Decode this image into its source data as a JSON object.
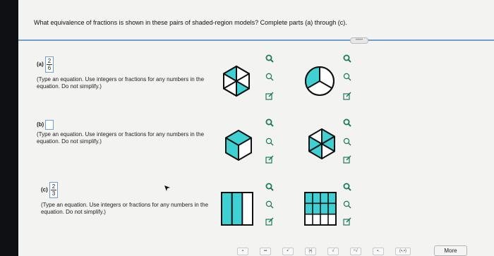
{
  "question": "What equivalence of fractions is shown in these pairs of shaded-region models? Complete parts (a) through (c).",
  "more_pill": "•••••",
  "parts": [
    {
      "label": "(a)",
      "fraction": {
        "numerator": "2",
        "denominator": "6"
      },
      "hint": "(Type an equation. Use integers or fractions for any numbers in the equation. Do not simplify.)"
    },
    {
      "label": "(b)",
      "hint": "(Type an equation. Use integers or fractions for any numbers in the equation. Do not simplify.)"
    },
    {
      "label": "(c)",
      "fraction": {
        "numerator": "2",
        "denominator": "3"
      },
      "hint": "(Type an equation. Use integers or fractions for any numbers in the equation. Do not simplify.)"
    }
  ],
  "models": {
    "a_left": {
      "shape": "hexagon split into 6",
      "shaded": 2,
      "total": 6
    },
    "a_right": {
      "shape": "circle split into 3",
      "shaded": 1,
      "total": 3
    },
    "b_left": {
      "shape": "hexagon split into 3 rhombi",
      "shaded": 2,
      "total": 3
    },
    "b_right": {
      "shape": "hexagon split into 6",
      "shaded": 4,
      "total": 6
    },
    "c_left": {
      "shape": "rectangle split into 3 columns",
      "shaded": 2,
      "total": 3
    },
    "c_right": {
      "shape": "rectangle split into 12 cells",
      "shaded": 8,
      "total": 12
    }
  },
  "colors": {
    "teal": "#3ed0d2",
    "outline": "#111111",
    "accent": "#6f9fcf",
    "icon": "#1a7a5e"
  },
  "toolbar": {
    "more_label": "More",
    "button_icons": [
      "fraction-icon",
      "mixed-number-icon",
      "exponent-icon",
      "absolute-value-icon",
      "sqrt-icon",
      "nth-root-icon",
      "decimal-icon",
      "interval-icon"
    ]
  }
}
